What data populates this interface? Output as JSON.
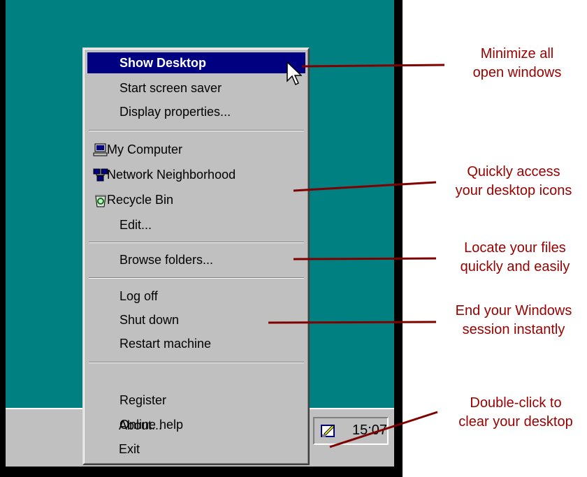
{
  "menu": {
    "items": [
      {
        "label": "Show Desktop",
        "selected": true,
        "icon": ""
      },
      {
        "label": "Start screen saver",
        "icon": ""
      },
      {
        "label": "Display properties...",
        "icon": ""
      },
      {
        "label": "My Computer",
        "icon": "computer-icon"
      },
      {
        "label": "Network Neighborhood",
        "icon": "network-icon"
      },
      {
        "label": "Recycle Bin",
        "icon": "recycle-bin-icon"
      },
      {
        "label": "Edit...",
        "icon": ""
      },
      {
        "label": "Browse folders...",
        "icon": ""
      },
      {
        "label": "Log off",
        "icon": ""
      },
      {
        "label": "Shut down",
        "icon": ""
      },
      {
        "label": "Restart machine",
        "icon": ""
      },
      {
        "label": "Register",
        "icon": ""
      },
      {
        "label": "Online help",
        "icon": ""
      },
      {
        "label": "About...",
        "icon": ""
      },
      {
        "label": "Exit",
        "icon": ""
      }
    ]
  },
  "taskbar": {
    "clock": "15:07",
    "tray_icon": "desktop-tray-icon"
  },
  "annotations": [
    {
      "line1": "Minimize all",
      "line2": "open windows"
    },
    {
      "line1": "Quickly access",
      "line2": "your desktop icons"
    },
    {
      "line1": "Locate your files",
      "line2": "quickly and easily"
    },
    {
      "line1": "End your Windows",
      "line2": "session instantly"
    },
    {
      "line1": "Double-click to",
      "line2": "clear your desktop"
    }
  ],
  "colors": {
    "desktop": "#008080",
    "menu": "#c0c0c0",
    "highlight": "#000080",
    "annotation": "#990000"
  }
}
